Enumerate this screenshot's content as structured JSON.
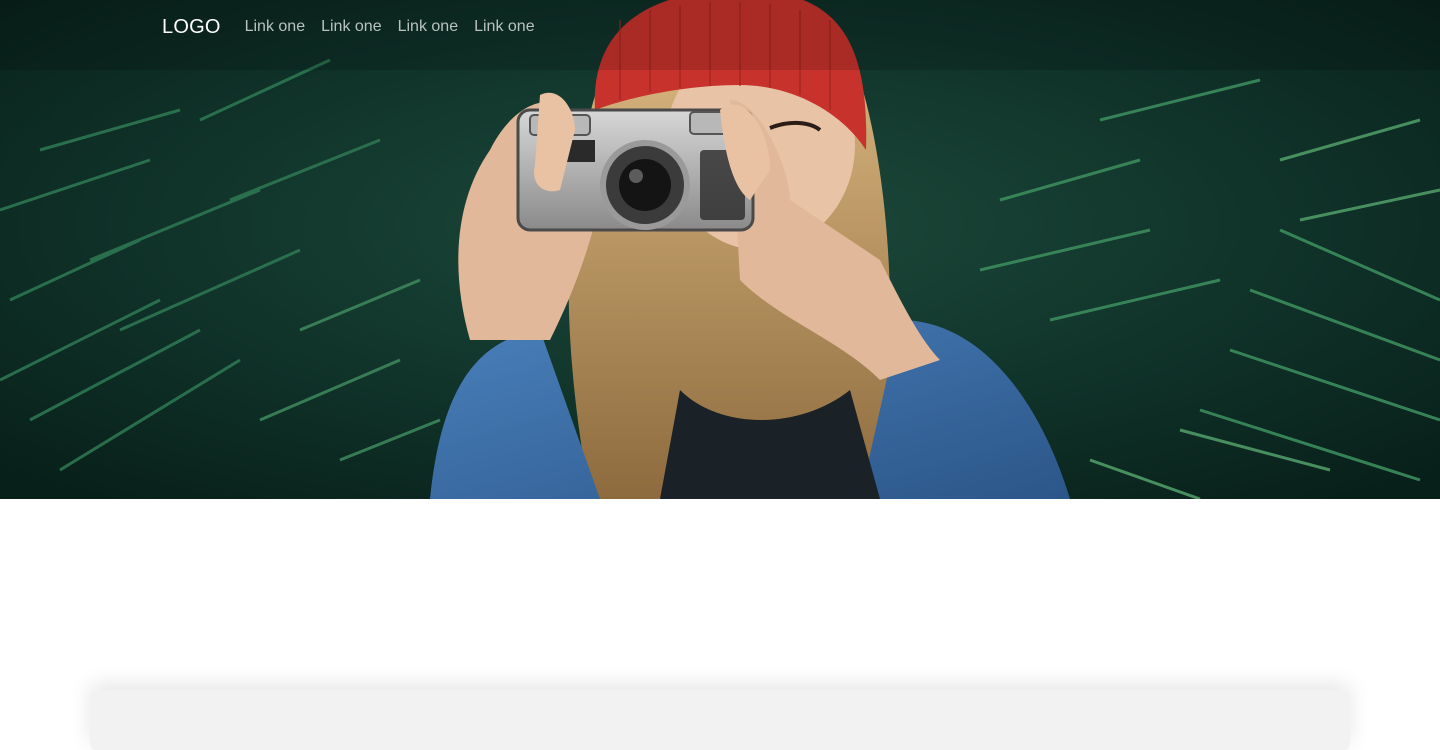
{
  "navbar": {
    "logo": "LOGO",
    "links": [
      {
        "label": "Link one"
      },
      {
        "label": "Link one"
      },
      {
        "label": "Link one"
      },
      {
        "label": "Link one"
      }
    ]
  },
  "hero": {
    "image_subject": "woman in red beanie and denim jacket holding a Contax film camera in front of evergreen branches"
  },
  "colors": {
    "foliage": "#1f5a3f",
    "beanie": "#c8322c",
    "denim": "#3a6ea8",
    "hair": "#c9a46a",
    "skin": "#e8c3a6"
  }
}
